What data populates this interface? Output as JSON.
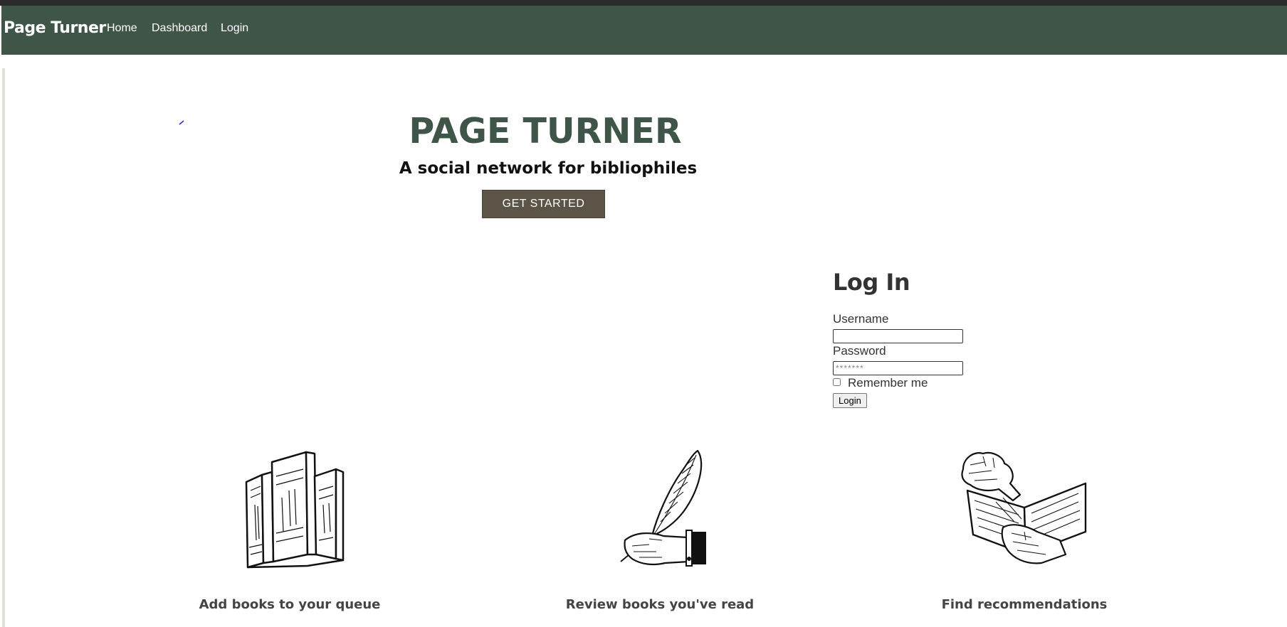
{
  "nav": {
    "brand": "Page Turner",
    "links": [
      {
        "label": "Home"
      },
      {
        "label": "Dashboard"
      },
      {
        "label": "Login"
      }
    ],
    "background": "#3e5548"
  },
  "hero": {
    "title": "PAGE TURNER",
    "subtitle": "A social network for bibliophiles",
    "cta_label": "GET STARTED",
    "title_color": "#3e5548",
    "cta_color": "#5d5448"
  },
  "login": {
    "title": "Log In",
    "username_label": "Username",
    "username_value": "",
    "password_label": "Password",
    "password_placeholder": "*******",
    "remember_label": "Remember me",
    "remember_checked": false,
    "submit_label": "Login"
  },
  "features": [
    {
      "caption": "Add books to your queue",
      "icon": "stacked-books-icon"
    },
    {
      "caption": "Review books you've read",
      "icon": "quill-pen-hand-icon"
    },
    {
      "caption": "Find recommendations",
      "icon": "hands-open-book-icon"
    }
  ]
}
